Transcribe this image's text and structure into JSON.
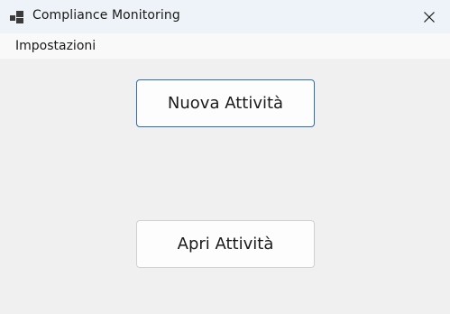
{
  "window": {
    "title": "Compliance Monitoring",
    "icon": "app-windows-icon",
    "close_icon": "close-icon"
  },
  "menu": {
    "items": [
      {
        "label": "Impostazioni"
      }
    ]
  },
  "main": {
    "new_activity_label": "Nuova Attività",
    "open_activity_label": "Apri Attività"
  },
  "colors": {
    "background": "#f0f0f0",
    "titlebar": "#edf3f8",
    "menubar": "#f9f9f9",
    "focus_border": "#2f6db3"
  }
}
